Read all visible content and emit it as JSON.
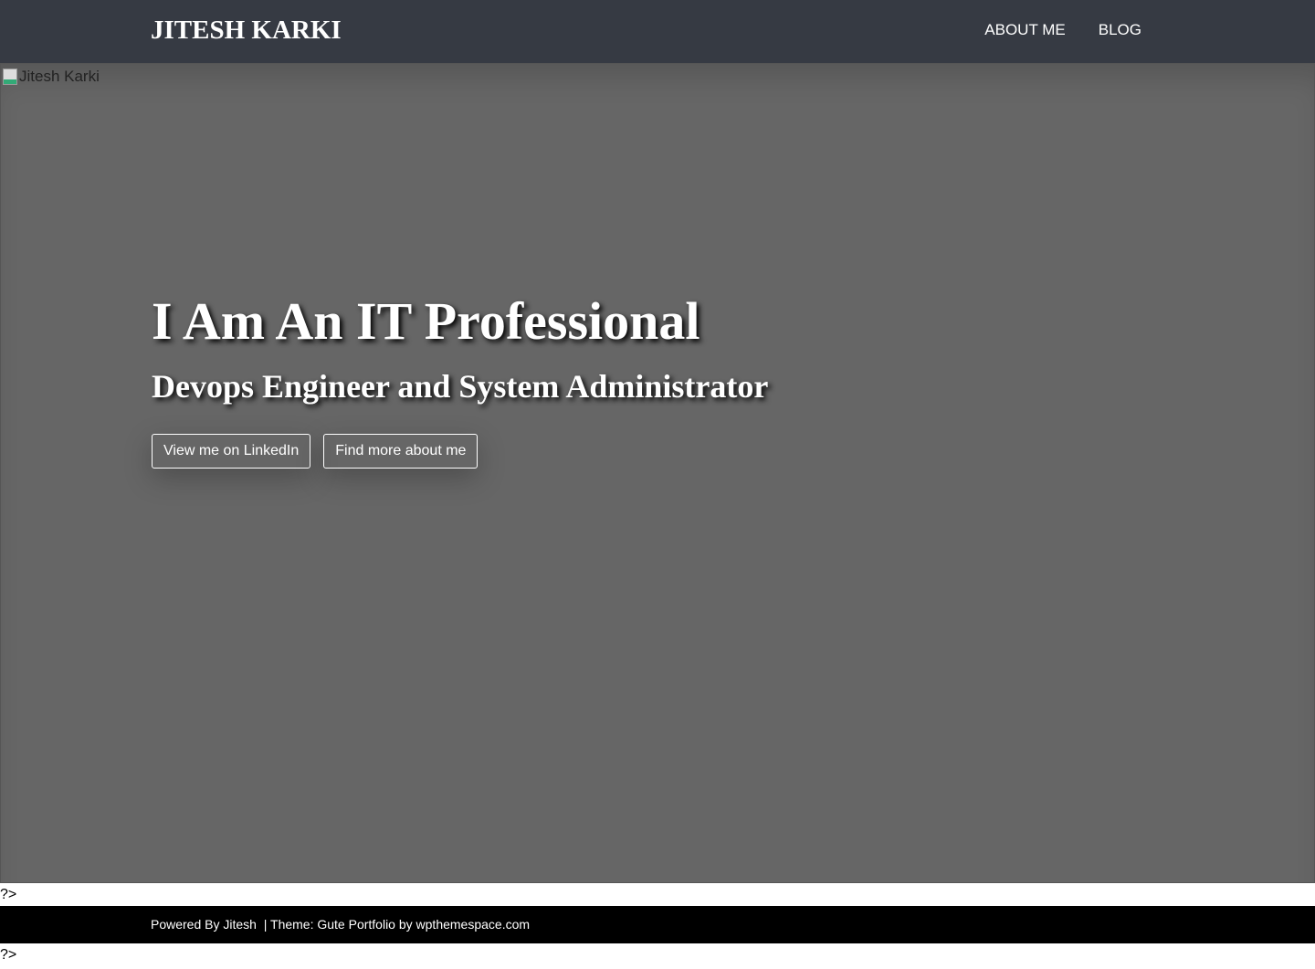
{
  "header": {
    "title": "JITESH KARKI",
    "nav": [
      {
        "label": "ABOUT ME"
      },
      {
        "label": "BLOG"
      }
    ]
  },
  "hero": {
    "image_alt": "Jitesh Karki",
    "title": "I Am An IT Professional",
    "subtitle": "Devops Engineer and System Administrator",
    "buttons": [
      {
        "label": "View me on LinkedIn"
      },
      {
        "label": "Find more about me"
      }
    ]
  },
  "stray_text": "?>",
  "footer": {
    "powered": "Powered By Jitesh",
    "separator": "|",
    "theme": "Theme: Gute Portfolio by wpthemespace.com"
  }
}
